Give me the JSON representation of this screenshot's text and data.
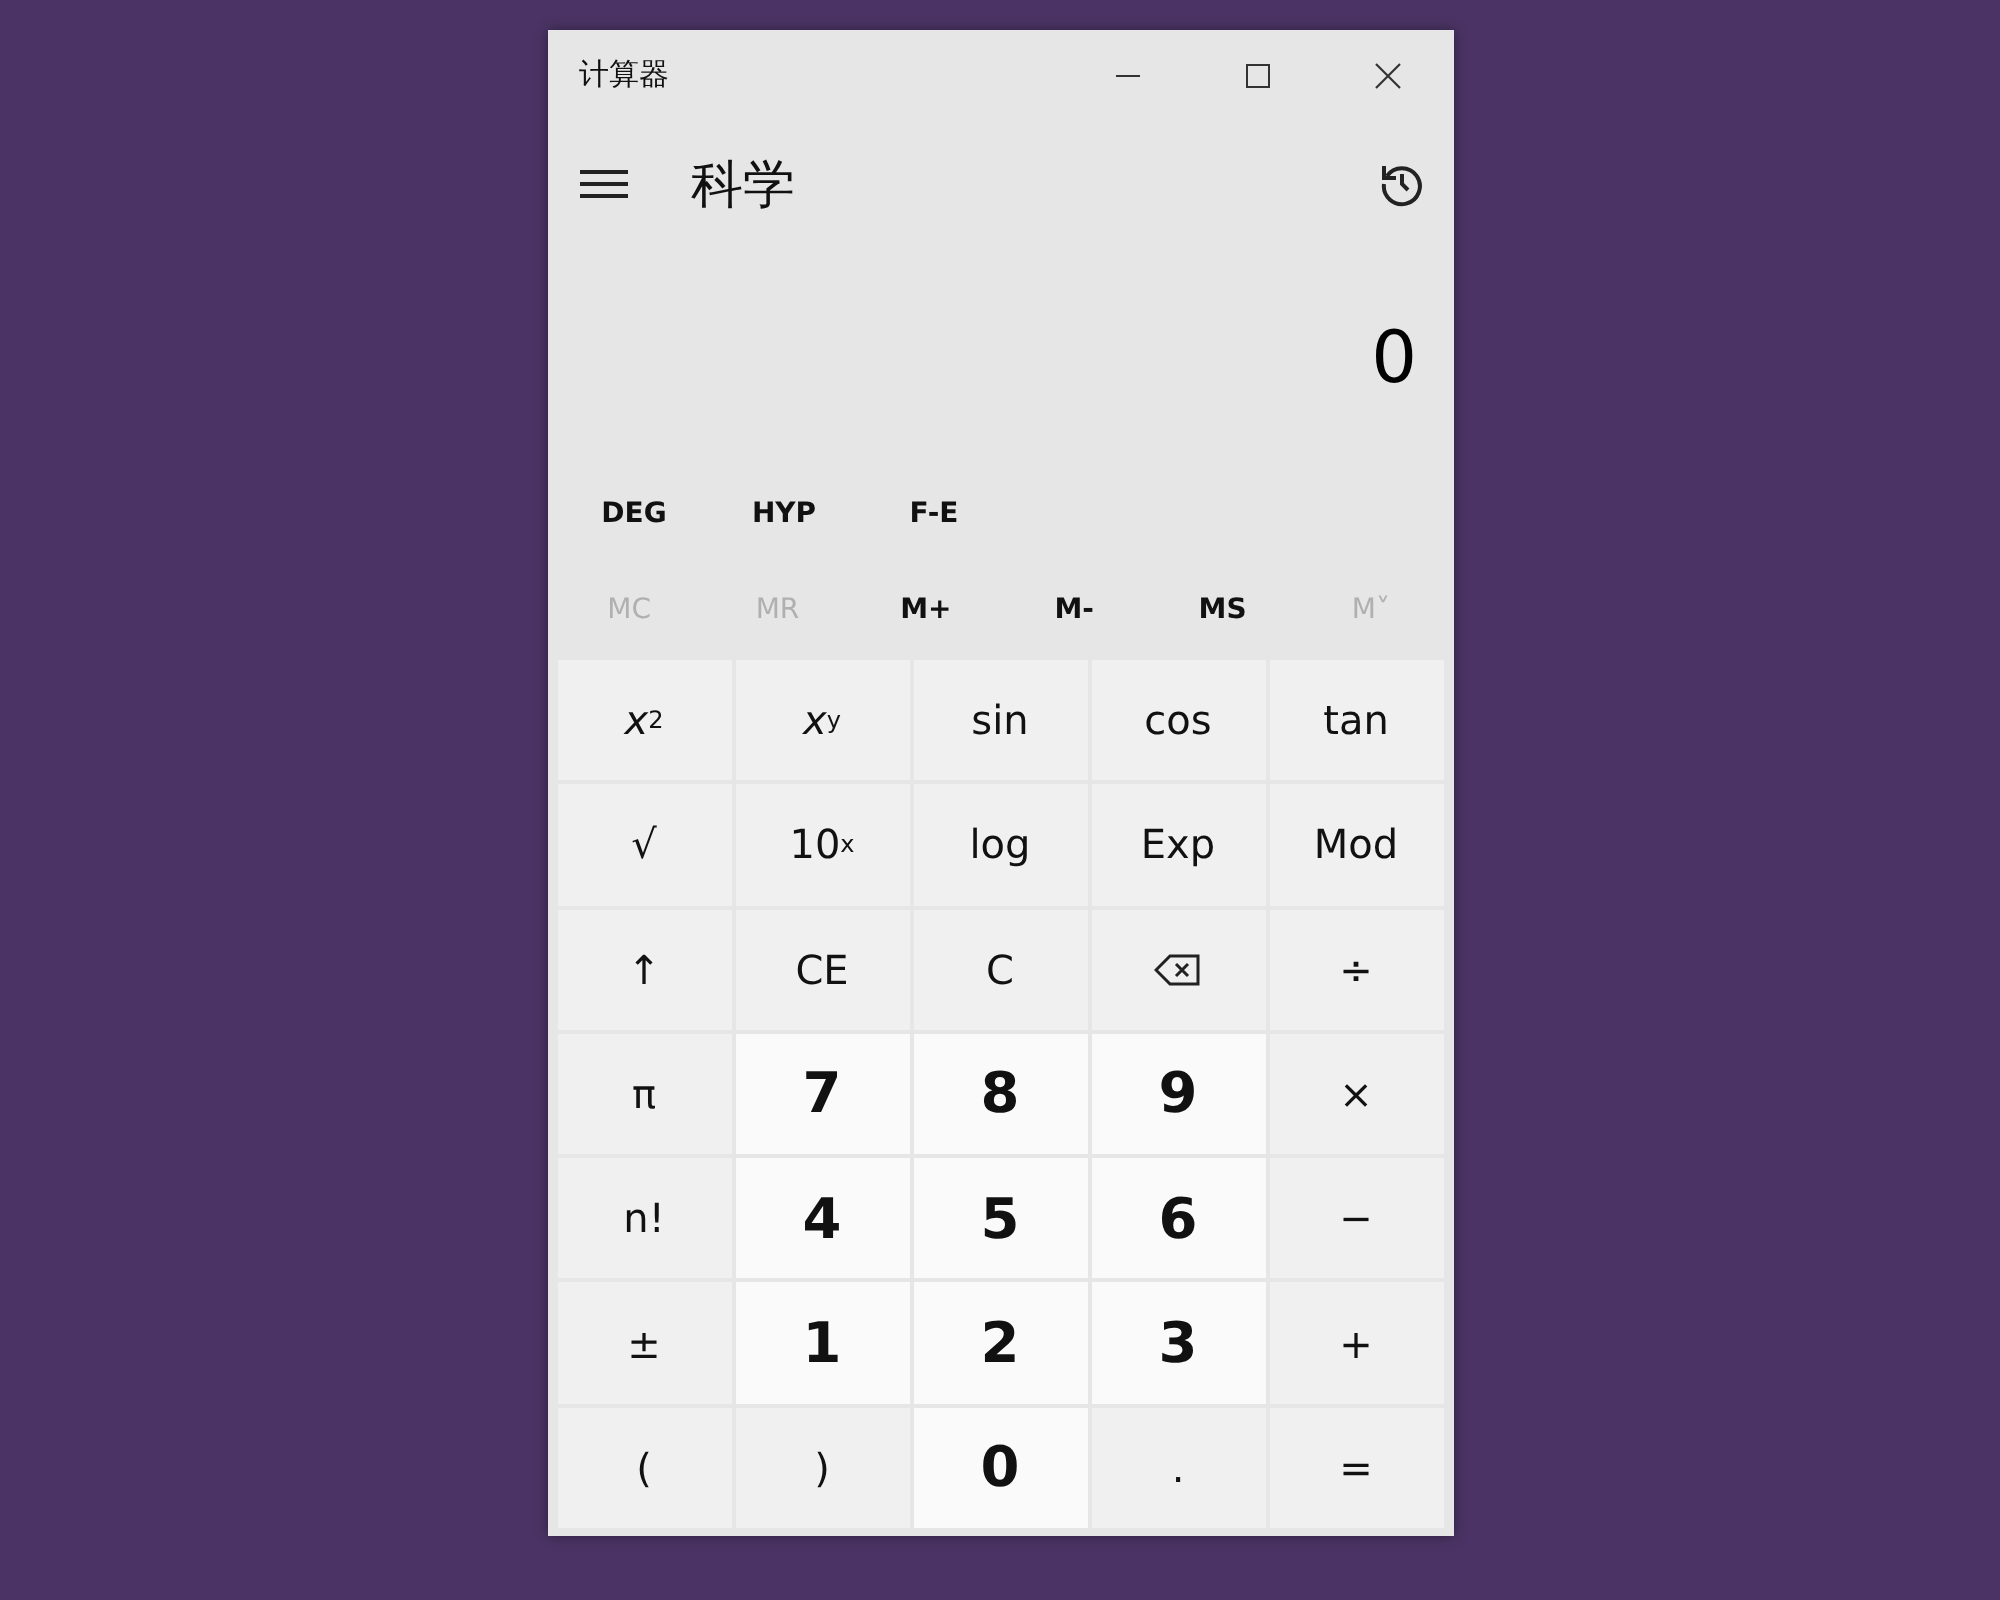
{
  "window": {
    "title": "计算器"
  },
  "header": {
    "mode": "科学"
  },
  "display": {
    "value": "0"
  },
  "options": [
    "DEG",
    "HYP",
    "F-E"
  ],
  "memory": [
    {
      "label": "MC",
      "disabled": true
    },
    {
      "label": "MR",
      "disabled": true
    },
    {
      "label": "M+",
      "disabled": false
    },
    {
      "label": "M-",
      "disabled": false
    },
    {
      "label": "MS",
      "disabled": false
    },
    {
      "label": "M˅",
      "disabled": true
    }
  ],
  "keys": [
    {
      "kind": "function",
      "label": "*x*$^{2}$"
    },
    {
      "kind": "function",
      "label": "*x*$^{y}$"
    },
    {
      "kind": "function",
      "label": "sin"
    },
    {
      "kind": "function",
      "label": "cos"
    },
    {
      "kind": "function",
      "label": "tan"
    },
    {
      "kind": "function",
      "label": "√"
    },
    {
      "kind": "function",
      "label": "10$^{x}$"
    },
    {
      "kind": "function",
      "label": "log"
    },
    {
      "kind": "function",
      "label": "Exp"
    },
    {
      "kind": "function",
      "label": "Mod"
    },
    {
      "kind": "function",
      "label": "↑"
    },
    {
      "kind": "function",
      "label": "CE"
    },
    {
      "kind": "function",
      "label": "C"
    },
    {
      "kind": "backspace"
    },
    {
      "kind": "function",
      "label": "÷"
    },
    {
      "kind": "function",
      "label": "π"
    },
    {
      "kind": "digit",
      "label": "7"
    },
    {
      "kind": "digit",
      "label": "8"
    },
    {
      "kind": "digit",
      "label": "9"
    },
    {
      "kind": "function",
      "label": "×"
    },
    {
      "kind": "function",
      "label": "n!"
    },
    {
      "kind": "digit",
      "label": "4"
    },
    {
      "kind": "digit",
      "label": "5"
    },
    {
      "kind": "digit",
      "label": "6"
    },
    {
      "kind": "function",
      "label": "−"
    },
    {
      "kind": "function",
      "label": "±"
    },
    {
      "kind": "digit",
      "label": "1"
    },
    {
      "kind": "digit",
      "label": "2"
    },
    {
      "kind": "digit",
      "label": "3"
    },
    {
      "kind": "function",
      "label": "+"
    },
    {
      "kind": "function",
      "label": "("
    },
    {
      "kind": "function",
      "label": ")"
    },
    {
      "kind": "digit",
      "label": "0"
    },
    {
      "kind": "function",
      "label": "."
    },
    {
      "kind": "function",
      "label": "="
    }
  ]
}
